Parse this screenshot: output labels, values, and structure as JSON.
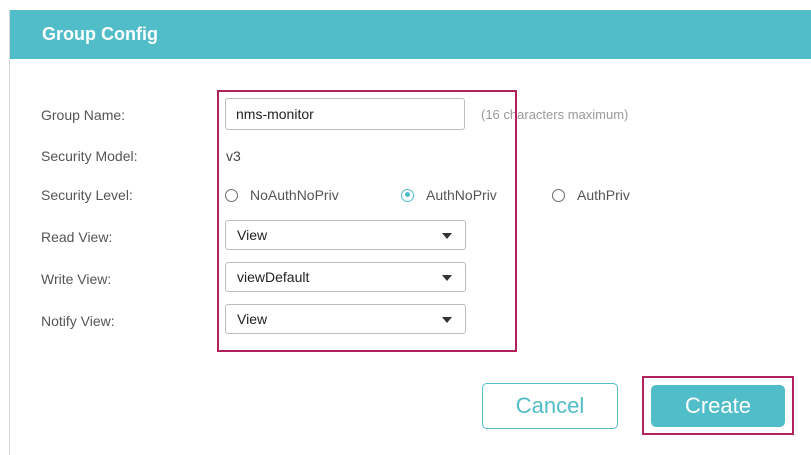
{
  "header": {
    "title": "Group Config"
  },
  "form": {
    "group_name": {
      "label": "Group Name:",
      "value": "nms-monitor",
      "hint": "(16 characters maximum)"
    },
    "security_model": {
      "label": "Security Model:",
      "value": "v3"
    },
    "security_level": {
      "label": "Security Level:",
      "options": [
        "NoAuthNoPriv",
        "AuthNoPriv",
        "AuthPriv"
      ],
      "selected": "AuthNoPriv"
    },
    "read_view": {
      "label": "Read View:",
      "value": "View"
    },
    "write_view": {
      "label": "Write View:",
      "value": "viewDefault"
    },
    "notify_view": {
      "label": "Notify View:",
      "value": "View"
    }
  },
  "actions": {
    "cancel_label": "Cancel",
    "create_label": "Create"
  },
  "colors": {
    "accent": "#51bdc8",
    "highlight": "#b0225c"
  },
  "icons": {
    "radio": "radio-icon",
    "dropdown": "chevron-down-icon"
  }
}
